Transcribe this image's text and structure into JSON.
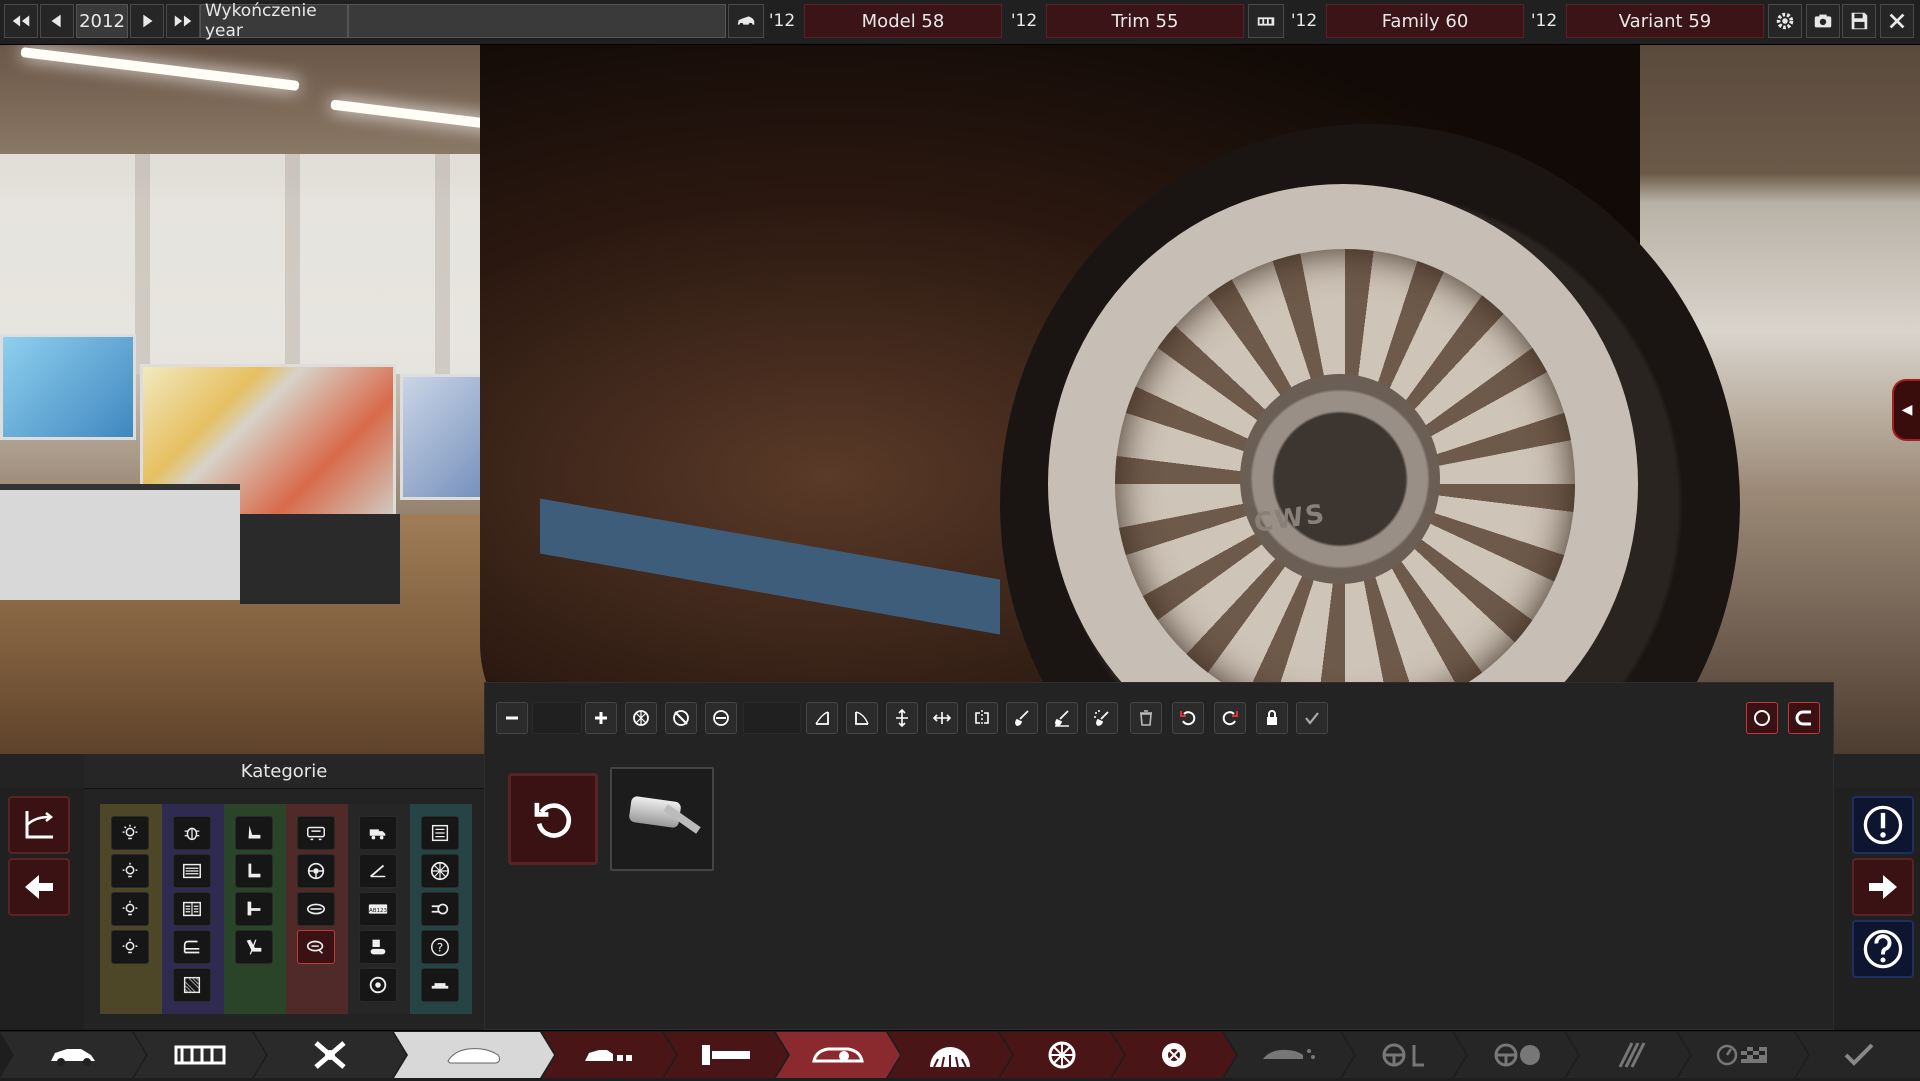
{
  "topbar": {
    "year": "2012",
    "field_label": "Wykończenie year",
    "model": {
      "year": "'12",
      "name": "Model 58"
    },
    "trim": {
      "year": "'12",
      "name": "Trim 55"
    },
    "family": {
      "year": "'12",
      "name": "Family 60"
    },
    "variant": {
      "year": "'12",
      "name": "Variant 59"
    },
    "icons": [
      "rewind-icon",
      "prev-icon",
      "next-icon",
      "fast-forward-icon",
      "car-icon",
      "engine-icon",
      "gear-icon",
      "camera-icon",
      "save-icon",
      "close-icon"
    ]
  },
  "viewport": {
    "hub_logo": "CWS"
  },
  "left_panel": {
    "category_title": "Kategorie",
    "buttons": [
      "corner-arrow-icon",
      "back-arrow-icon"
    ]
  },
  "categories": {
    "columns": [
      {
        "color": "#5a5330",
        "icons": [
          "light-icon",
          "light-icon",
          "light-icon",
          "light-icon"
        ]
      },
      {
        "color": "#34305a",
        "icons": [
          "bug-icon",
          "grille-icon",
          "vent-icon",
          "bumper-icon",
          "mesh-icon"
        ]
      },
      {
        "color": "#2f4a2f",
        "icons": [
          "seat-icon",
          "seat-back-icon",
          "seat-side-icon",
          "seat-recline-icon"
        ]
      },
      {
        "color": "#5a2d2d",
        "icons": [
          "dashboard-icon",
          "wheel-icon",
          "handle-icon",
          "mirror-icon"
        ]
      },
      {
        "color": "#2a2a2a",
        "icons": [
          "truck-icon",
          "wiper-icon",
          "plate-icon",
          "hitch-icon",
          "target-icon"
        ]
      },
      {
        "color": "#2b4a4a",
        "icons": [
          "panel-icon",
          "rim-icon",
          "exhaust-icon",
          "help-icon",
          "sill-icon"
        ]
      }
    ],
    "active": "mirror-icon"
  },
  "toolbar": {
    "tools": [
      "minus-icon",
      "blank",
      "plus-icon",
      "wheel-add-icon",
      "wheel-remove-icon",
      "oval-icon",
      "blank",
      "scale-corner-icon",
      "skew-icon",
      "move-vertical-icon",
      "move-horizontal-icon",
      "mirror-sym-icon",
      "paint-icon",
      "paint-fill-icon",
      "spray-icon",
      "trash-icon",
      "undo-icon",
      "redo-icon",
      "lock-icon",
      "check-icon"
    ],
    "right_tools": [
      "circle-icon",
      "magnet-icon"
    ]
  },
  "parts": {
    "reset_icon": "reset-icon",
    "selected_part": "side-mirror"
  },
  "right_panel": {
    "buttons": [
      "info-icon",
      "forward-arrow-icon",
      "question-icon"
    ]
  },
  "bottom_nav": {
    "steps": [
      {
        "name": "car",
        "state": "done"
      },
      {
        "name": "chassis",
        "state": "done"
      },
      {
        "name": "suspension",
        "state": "done"
      },
      {
        "name": "body",
        "state": "active"
      },
      {
        "name": "trims",
        "state": "red"
      },
      {
        "name": "fixtures",
        "state": "red"
      },
      {
        "name": "lights",
        "state": "redactive"
      },
      {
        "name": "interior",
        "state": "red"
      },
      {
        "name": "wheels",
        "state": "red"
      },
      {
        "name": "brakes",
        "state": "red"
      },
      {
        "name": "aero",
        "state": "dim"
      },
      {
        "name": "steering",
        "state": "dim"
      },
      {
        "name": "dashboard",
        "state": "dim"
      },
      {
        "name": "tools",
        "state": "dim"
      },
      {
        "name": "test",
        "state": "dim"
      },
      {
        "name": "finish",
        "state": "dim"
      }
    ]
  }
}
